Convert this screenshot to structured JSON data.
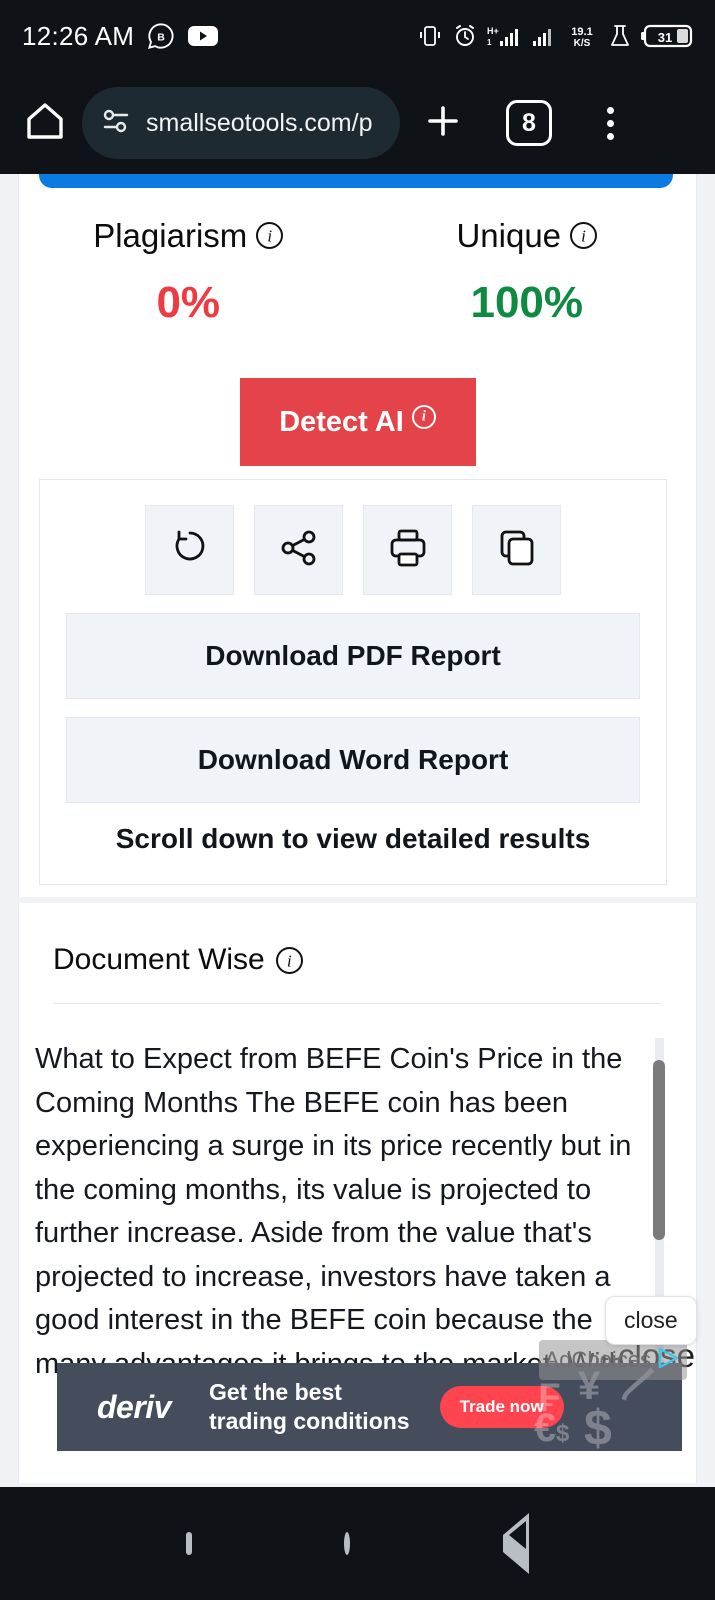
{
  "status_bar": {
    "time": "12:26 AM",
    "left_icons": [
      "whatsapp-business-icon",
      "youtube-icon"
    ],
    "right_icons": [
      "vibrate-icon",
      "alarm-icon",
      "hplus-signal-icon",
      "signal-bars-icon",
      "data-speed-icon",
      "lab-flask-icon",
      "battery-icon"
    ],
    "data_speed_value": "19.1",
    "data_speed_unit": "K/S",
    "network_type": "H+",
    "battery_percent": "31"
  },
  "browser": {
    "home_icon": "home-icon",
    "site_settings_icon": "tune-icon",
    "url": "smallseotools.com/p",
    "new_tab_icon": "plus-icon",
    "tab_count": "8",
    "menu_icon": "three-dot-menu-icon"
  },
  "results": {
    "plagiarism_label": "Plagiarism",
    "plagiarism_value": "0%",
    "unique_label": "Unique",
    "unique_value": "100%",
    "detect_ai_label": "Detect AI",
    "icon_buttons": [
      {
        "name": "rewind-icon",
        "title": "Recheck"
      },
      {
        "name": "share-icon",
        "title": "Share"
      },
      {
        "name": "print-icon",
        "title": "Print"
      },
      {
        "name": "copy-icon",
        "title": "Copy"
      }
    ],
    "download_pdf_label": "Download PDF Report",
    "download_word_label": "Download Word Report",
    "scroll_hint": "Scroll down to view detailed results",
    "accent_blue": "#0b7ae0",
    "plagiarism_color": "#ed3b42",
    "unique_color": "#0f8a43",
    "detect_ai_color": "#e4434a"
  },
  "document_wise": {
    "heading": "Document Wise",
    "text": "What to Expect from BEFE Coin's Price in the Coming Months\nThe BEFE coin has been experiencing a surge in its price recently but in the coming months, its value is projected to further increase. Aside from the value that's projected to increase, investors have taken a good interest in the BEFE coin because the many advantages it brings to the market. With"
  },
  "overlay": {
    "close_pill_label": "close",
    "close_ghost_label": "close"
  },
  "ad": {
    "brand": "deriv",
    "headline_line1": "Get the best",
    "headline_line2": "trading conditions",
    "cta_label": "Trade now",
    "adchoices_label": "AdChoices",
    "currency_symbols": [
      "₣",
      "¥",
      "₮",
      "€",
      "$",
      "$"
    ],
    "background_color": "#454c5c",
    "cta_color": "#ff444f"
  },
  "nav_bar": {
    "recents_icon": "square-recents-icon",
    "home_icon": "circle-home-icon",
    "back_icon": "triangle-back-icon"
  }
}
